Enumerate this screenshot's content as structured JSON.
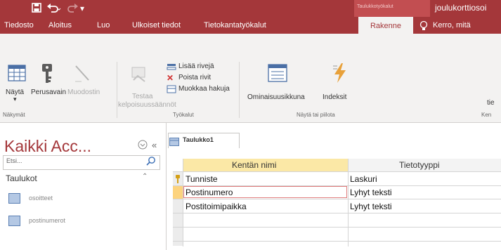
{
  "titlebar": {
    "contextual_group": "Taulukkotyökalut",
    "document_title": "joulukorttiosoi"
  },
  "tabs": [
    {
      "label": "Tiedosto"
    },
    {
      "label": "Aloitus"
    },
    {
      "label": "Luo"
    },
    {
      "label": "Ulkoiset tiedot"
    },
    {
      "label": "Tietokantatyökalut"
    },
    {
      "label": "Rakenne"
    }
  ],
  "tellme": "Kerro, mitä",
  "ribbon": {
    "view_label": "Näytä",
    "primary_key_label": "Perusavain",
    "builder_label": "Muodostin",
    "test_rules_label": "Testaa",
    "test_rules_label2": "kelpoisuussäännöt",
    "insert_rows": "Lisää rivejä",
    "delete_rows": "Poista rivit",
    "modify_lookups": "Muokkaa hakuja",
    "property_sheet": "Ominaisuusikkuna",
    "indexes": "Indeksit",
    "cut_off": "tie",
    "group_views": "Näkymät",
    "group_tools": "Työkalut",
    "group_showhide": "Näytä tai piilota",
    "group_cut": "Ken"
  },
  "nav": {
    "title": "Kaikki Acc...",
    "search_placeholder": "Etsi...",
    "section": "Taulukot",
    "items": [
      {
        "label": "osoitteet"
      },
      {
        "label": "postinumerot"
      }
    ]
  },
  "document": {
    "tab_label": "Taulukko1",
    "col_field_name": "Kentän nimi",
    "col_data_type": "Tietotyyppi",
    "rows": [
      {
        "field": "Tunniste",
        "type": "Laskuri"
      },
      {
        "field": "Postinumero",
        "type": "Lyhyt teksti"
      },
      {
        "field": "Postitoimipaikka",
        "type": "Lyhyt teksti"
      }
    ]
  },
  "colors": {
    "accent": "#a4373a",
    "header_cell": "#fbe8a6",
    "selector_highlight": "#fcd37e"
  }
}
